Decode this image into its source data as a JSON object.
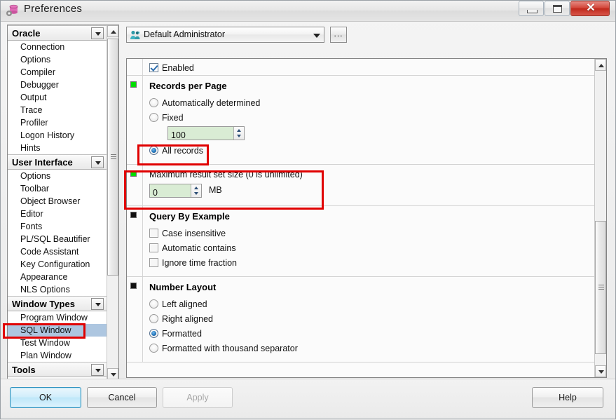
{
  "window": {
    "title": "Preferences",
    "title_icon": "database-gear-icon",
    "controls": {
      "minimize": "minimize-icon",
      "maximize": "restore-icon",
      "close": "✕"
    }
  },
  "sidebar": {
    "scroll": {
      "up": "scroll-up-arrow",
      "down": "scroll-down-arrow"
    },
    "groups": [
      {
        "label": "Oracle",
        "expander": "collapse-arrow",
        "items": [
          {
            "label": "Connection",
            "selected": false
          },
          {
            "label": "Options",
            "selected": false
          },
          {
            "label": "Compiler",
            "selected": false
          },
          {
            "label": "Debugger",
            "selected": false
          },
          {
            "label": "Output",
            "selected": false
          },
          {
            "label": "Trace",
            "selected": false
          },
          {
            "label": "Profiler",
            "selected": false
          },
          {
            "label": "Logon History",
            "selected": false
          },
          {
            "label": "Hints",
            "selected": false
          }
        ]
      },
      {
        "label": "User Interface",
        "expander": "collapse-arrow",
        "items": [
          {
            "label": "Options",
            "selected": false
          },
          {
            "label": "Toolbar",
            "selected": false
          },
          {
            "label": "Object Browser",
            "selected": false
          },
          {
            "label": "Editor",
            "selected": false
          },
          {
            "label": "Fonts",
            "selected": false
          },
          {
            "label": "PL/SQL Beautifier",
            "selected": false
          },
          {
            "label": "Code Assistant",
            "selected": false
          },
          {
            "label": "Key Configuration",
            "selected": false
          },
          {
            "label": "Appearance",
            "selected": false
          },
          {
            "label": "NLS Options",
            "selected": false
          }
        ]
      },
      {
        "label": "Window Types",
        "expander": "collapse-arrow",
        "items": [
          {
            "label": "Program Window",
            "selected": false
          },
          {
            "label": "SQL Window",
            "selected": true
          },
          {
            "label": "Test Window",
            "selected": false
          },
          {
            "label": "Plan Window",
            "selected": false
          }
        ]
      },
      {
        "label": "Tools",
        "expander": "collapse-arrow",
        "items": []
      }
    ]
  },
  "profile": {
    "icon": "users-icon",
    "value": "Default Administrator",
    "dropdown_icon": "chevron-down-icon",
    "ellipsis_label": "..."
  },
  "options": {
    "enabled": {
      "label": "Enabled",
      "checked": true
    },
    "sections": [
      {
        "title": "Records per Page",
        "marker": "green",
        "radios": [
          {
            "label": "Automatically determined",
            "selected": false
          },
          {
            "label": "Fixed",
            "selected": false
          },
          {
            "label": "All records",
            "selected": true
          }
        ],
        "fixed_value": "100"
      },
      {
        "title": "Maximum result set size (0 is unlimited)",
        "marker": "green",
        "value": "0",
        "unit": "MB"
      },
      {
        "title": "Query By Example",
        "marker": "black",
        "checkboxes": [
          {
            "label": "Case insensitive",
            "checked": false
          },
          {
            "label": "Automatic contains",
            "checked": false
          },
          {
            "label": "Ignore time fraction",
            "checked": false
          }
        ]
      },
      {
        "title": "Number Layout",
        "marker": "black",
        "radios": [
          {
            "label": "Left aligned",
            "selected": false
          },
          {
            "label": "Right aligned",
            "selected": false
          },
          {
            "label": "Formatted",
            "selected": true
          },
          {
            "label": "Formatted with thousand separator",
            "selected": false
          }
        ]
      }
    ]
  },
  "buttons": {
    "ok": "OK",
    "cancel": "Cancel",
    "apply": "Apply",
    "help": "Help"
  },
  "colors": {
    "highlight_box": "#e00000",
    "selection": "#adc6e0",
    "modified_marker": "#00dd00",
    "field_background": "#d9ecd4"
  }
}
